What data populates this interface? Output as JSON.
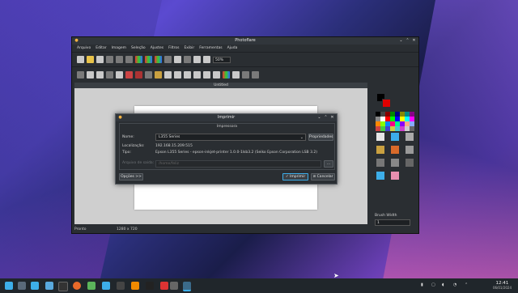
{
  "window": {
    "title": "Photoflare"
  },
  "menu": [
    "Arquivo",
    "Editar",
    "Imagem",
    "Seleção",
    "Ajustes",
    "Filtros",
    "Exibir",
    "Ferramentas",
    "Ajuda"
  ],
  "toolbar": {
    "zoom": "50%"
  },
  "canvas": {
    "title": "Untitled"
  },
  "status": {
    "left": "Pronto",
    "size": "1280 x 720"
  },
  "panel": {
    "brush_width_label": "Brush Width",
    "brush_width_value": "1"
  },
  "dialog": {
    "title": "Imprimir",
    "group_title": "Impressora",
    "name_label": "Nome:",
    "printer": "L355 Series",
    "properties_button": "Propriedades",
    "location_label": "Localização:",
    "location_value": "192.168.15.209:515",
    "type_label": "Tipo:",
    "type_value": "Epson L355 Series - epson-inkjet-printer 1.0.0-1lsb3.2 (Seiko Epson Corporation LSB 3.2)",
    "output_file_label": "Arquivo de saída:",
    "output_file_placeholder": "/home/feliz",
    "browse_button": "...",
    "options_button": "Opções >>",
    "print_button": "✓ Imprimir",
    "cancel_button": "⊘ Cancelar"
  },
  "taskbar": {
    "time": "12:41",
    "date": "06/01/2024"
  },
  "colors": {
    "primary": "#000000",
    "secondary": "#e00000",
    "accent": "#3daee9"
  }
}
